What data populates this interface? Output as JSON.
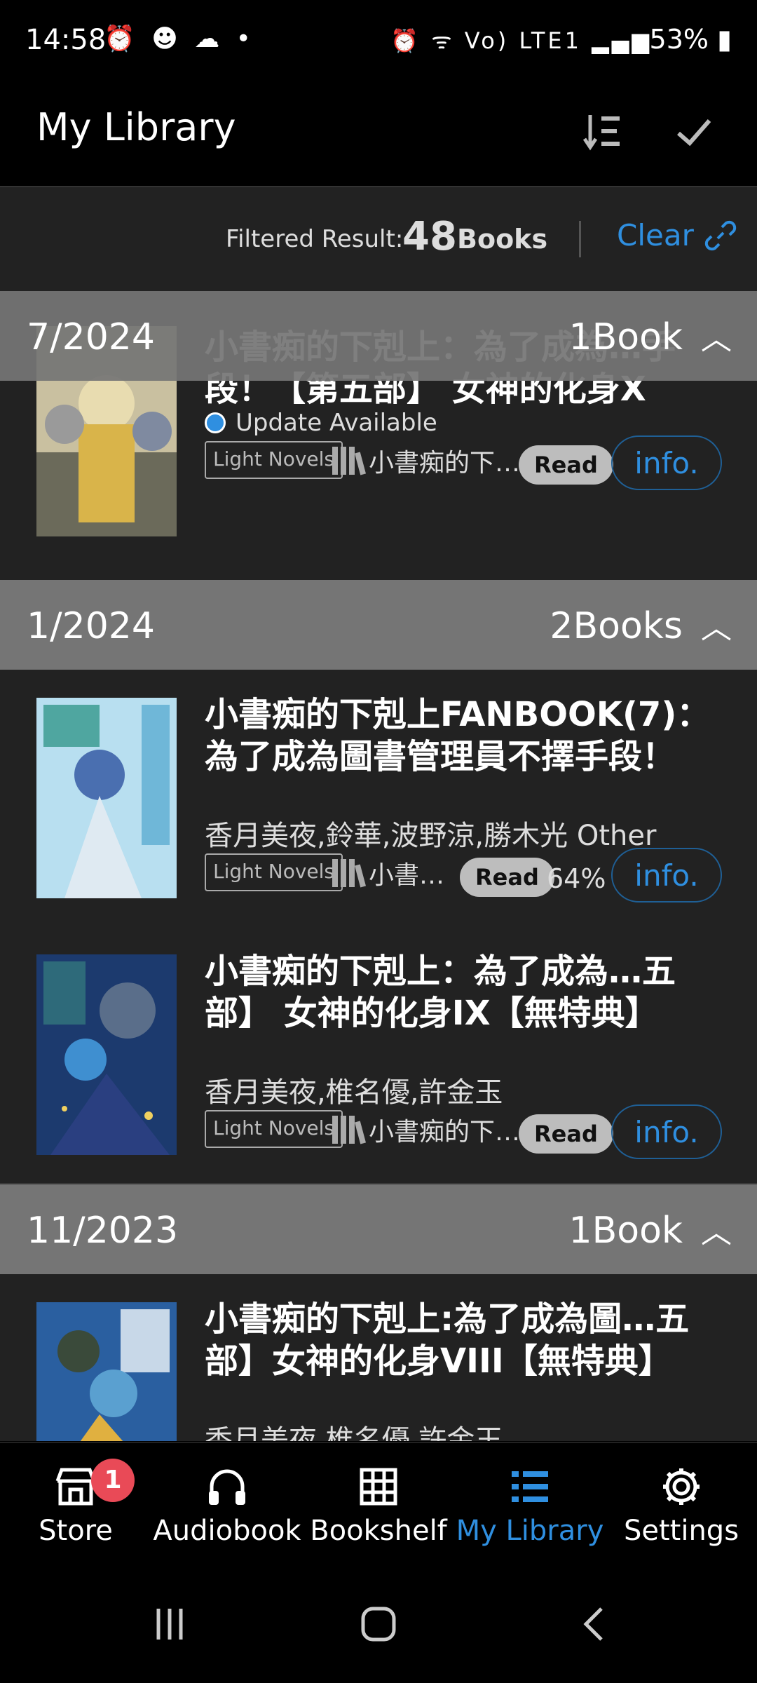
{
  "status_bar": {
    "time": "14:58",
    "left_icons": "⏰ ☻ ☁ •",
    "right_icons": "⏰ ᯤ Vo) LTE1 ▂▄▆",
    "battery": "53%"
  },
  "app_bar": {
    "title": "My Library"
  },
  "filter": {
    "label": "Filtered Result:",
    "count": "48",
    "unit": "Books",
    "clear_label": "Clear"
  },
  "sections": [
    {
      "date": "7/2024",
      "count": "1Book",
      "books": [
        {
          "title": "小書痴的下剋上：為了成為…手段！【第五部】 女神的化身X",
          "update": "Update Available",
          "category": "Light Novels",
          "series": "小書痴的下…",
          "read_label": "Read",
          "info_label": "info."
        }
      ]
    },
    {
      "date": "1/2024",
      "count": "2Books",
      "books": [
        {
          "title": "小書痴的下剋上FANBOOK(7)：為了成為圖書管理員不擇手段！",
          "authors": "香月美夜,鈴華,波野涼,勝木光 Other",
          "category": "Light Novels",
          "series": "小書…",
          "read_label": "Read",
          "progress": "64%",
          "info_label": "info."
        },
        {
          "title": "小書痴的下剋上：為了成為…五部】 女神的化身IX【無特典】",
          "authors": "香月美夜,椎名優,許金玉",
          "category": "Light Novels",
          "series": "小書痴的下…",
          "read_label": "Read",
          "info_label": "info."
        }
      ]
    },
    {
      "date": "11/2023",
      "count": "1Book",
      "books": [
        {
          "title": "小書痴的下剋上:為了成為圖…五部】女神的化身VIII【無特典】",
          "authors": "香月美夜,椎名優,許金玉"
        }
      ]
    }
  ],
  "bottom_nav": {
    "items": [
      {
        "label": "Store",
        "icon": "store-icon",
        "badge": "1"
      },
      {
        "label": "Audiobook",
        "icon": "headphones-icon"
      },
      {
        "label": "Bookshelf",
        "icon": "grid-icon"
      },
      {
        "label": "My Library",
        "icon": "list-icon",
        "active": true
      },
      {
        "label": "Settings",
        "icon": "gear-icon"
      }
    ]
  },
  "colors": {
    "accent": "#2f8fe0",
    "section_header": "#757575",
    "row_bg": "#222222",
    "badge": "#e94a57"
  }
}
